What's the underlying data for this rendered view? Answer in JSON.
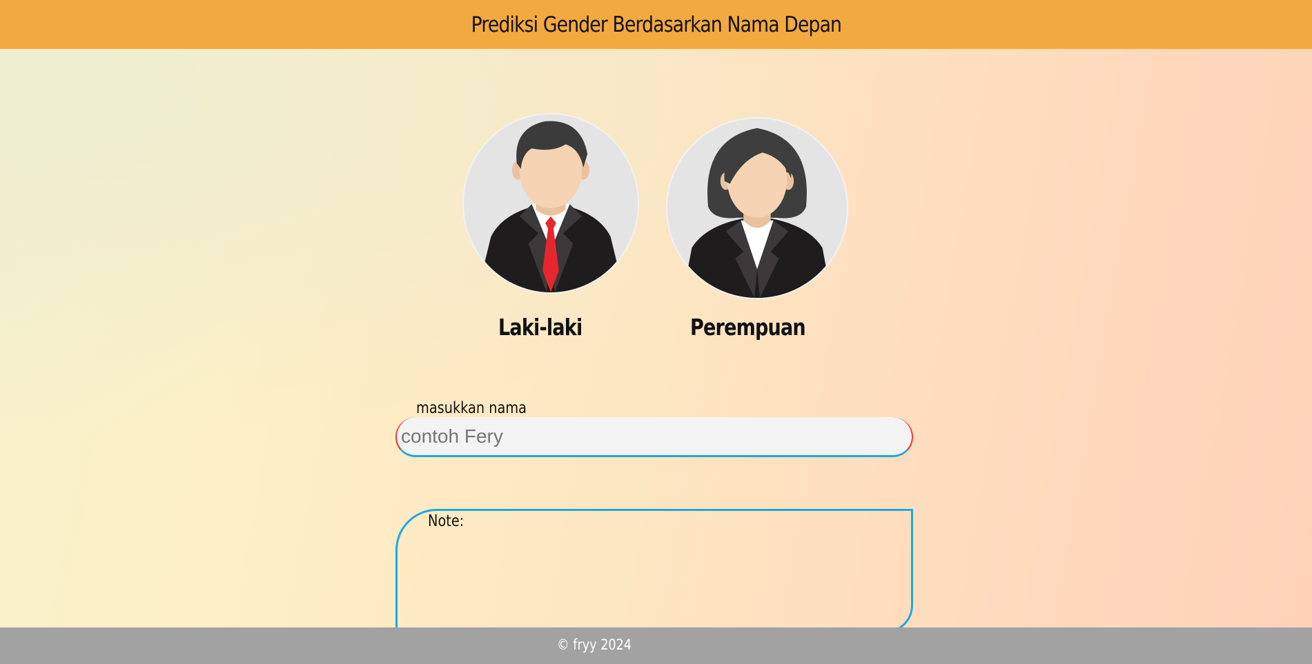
{
  "header": {
    "title": "Prediksi Gender Berdasarkan Nama Depan"
  },
  "genders": {
    "male": {
      "label": "Laki-laki",
      "icon": "man-avatar-icon"
    },
    "female": {
      "label": "Perempuan",
      "icon": "woman-avatar-icon"
    }
  },
  "form": {
    "input_label": "masukkan nama",
    "input_placeholder": "contoh Fery",
    "input_value": ""
  },
  "note": {
    "label": "Note:"
  },
  "footer": {
    "text": "© fryy 2024"
  },
  "colors": {
    "header_bg": "#f2a940",
    "footer_bg": "#a2a2a2",
    "input_accent": "#1ea7e4",
    "input_edge": "#e23a3a"
  }
}
